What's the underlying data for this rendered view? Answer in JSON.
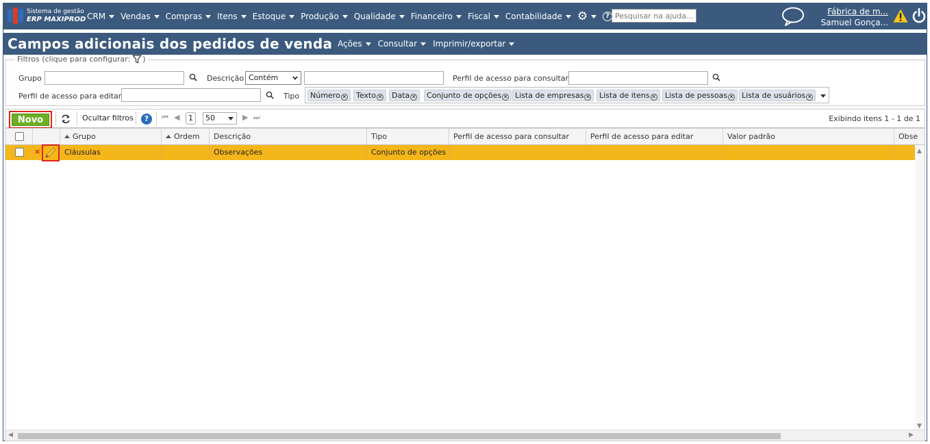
{
  "app": {
    "brand_line1": "Sistema de gestão",
    "brand_line2": "ERP MAXIPROD",
    "menu": [
      "CRM",
      "Vendas",
      "Compras",
      "Itens",
      "Estoque",
      "Produção",
      "Qualidade",
      "Financeiro",
      "Fiscal",
      "Contabilidade"
    ],
    "help_search_placeholder": "Pesquisar na ajuda...",
    "company": "Fábrica de m...",
    "user": "Samuel Gonça..."
  },
  "page": {
    "title": "Campos adicionais dos pedidos de venda",
    "menus": [
      "Ações",
      "Consultar",
      "Imprimir/exportar"
    ]
  },
  "filters": {
    "legend": "Filtros (clique para configurar:",
    "legend_close": ")",
    "grupo_label": "Grupo",
    "grupo_value": "",
    "descricao_label": "Descrição",
    "descricao_operator": "Contém",
    "descricao_value": "",
    "perfil_consultar_label": "Perfil de acesso para consultar",
    "perfil_consultar_value": "",
    "perfil_editar_label": "Perfil de acesso para editar",
    "perfil_editar_value": "",
    "tipo_label": "Tipo",
    "tipo_chips": [
      "Número",
      "Texto",
      "Data",
      "Conjunto de opções",
      "Lista de empresas",
      "Lista de itens",
      "Lista de pessoas",
      "Lista de usuários"
    ]
  },
  "toolbar": {
    "new_label": "Novo",
    "hide_filters_label": "Ocultar filtros",
    "page": "1",
    "page_size": "50",
    "items_info": "Exibindo itens 1 - 1 de 1"
  },
  "grid": {
    "columns": [
      "Grupo",
      "Ordem",
      "Descrição",
      "Tipo",
      "Perfil de acesso para consultar",
      "Perfil de acesso para editar",
      "Valor padrão",
      "Obse"
    ],
    "rows": [
      {
        "grupo": "Cláusulas",
        "ordem": "",
        "descricao": "Observações",
        "tipo": "Conjunto de opções",
        "perfil_consultar": "",
        "perfil_editar": "",
        "valor_padrao": ""
      }
    ]
  },
  "colors": {
    "header_bg": "#3b5a7e",
    "new_button": "#6cb023",
    "selected_row": "#f5b619",
    "highlight_border": "#d9231b"
  }
}
